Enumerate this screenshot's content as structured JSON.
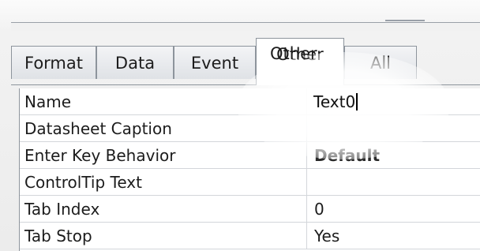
{
  "tabs": [
    {
      "label": "Format",
      "active": false
    },
    {
      "label": "Data",
      "active": false
    },
    {
      "label": "Event",
      "active": false
    },
    {
      "label": "Other",
      "active": true
    },
    {
      "label": "All",
      "active": false
    }
  ],
  "properties": [
    {
      "name": "Name",
      "value": "Text0"
    },
    {
      "name": "Datasheet Caption",
      "value": ""
    },
    {
      "name": "Enter Key Behavior",
      "value": "Default"
    },
    {
      "name": "ControlTip Text",
      "value": ""
    },
    {
      "name": "Tab Index",
      "value": "0"
    },
    {
      "name": "Tab Stop",
      "value": "Yes"
    }
  ]
}
